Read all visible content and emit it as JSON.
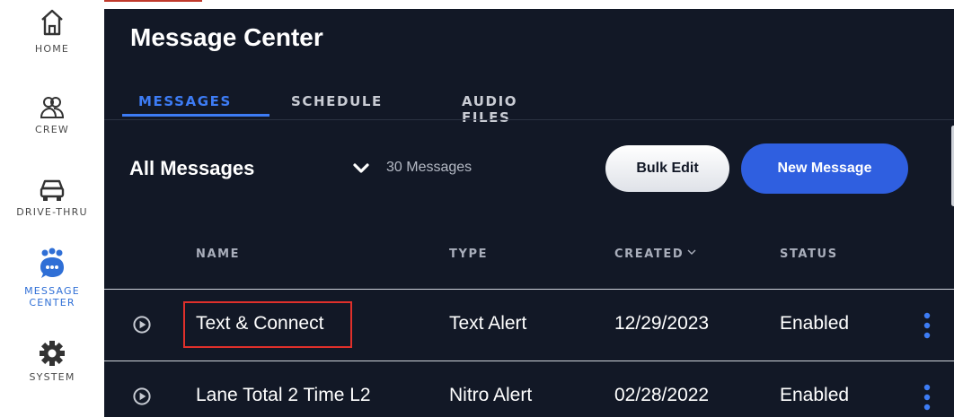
{
  "sidebar": {
    "items": [
      {
        "label": "HOME",
        "icon": "home-icon"
      },
      {
        "label": "CREW",
        "icon": "crew-icon"
      },
      {
        "label": "DRIVE-THRU",
        "icon": "car-icon"
      },
      {
        "label": "MESSAGE CENTER",
        "icon": "message-center-icon",
        "active": true
      },
      {
        "label": "SYSTEM",
        "icon": "gear-icon"
      }
    ]
  },
  "header": {
    "title": "Message Center"
  },
  "tabs": [
    {
      "label": "MESSAGES",
      "active": true
    },
    {
      "label": "SCHEDULE"
    },
    {
      "label": "AUDIO FILES"
    }
  ],
  "filter": {
    "label": "All Messages",
    "count": "30 Messages"
  },
  "buttons": {
    "bulk_edit": "Bulk Edit",
    "new_message": "New Message"
  },
  "table": {
    "columns": [
      "NAME",
      "TYPE",
      "CREATED",
      "STATUS"
    ],
    "rows": [
      {
        "name": "Text & Connect",
        "type": "Text Alert",
        "created": "12/29/2023",
        "status": "Enabled"
      },
      {
        "name": "Lane Total 2 Time L2",
        "type": "Nitro Alert",
        "created": "02/28/2022",
        "status": "Enabled"
      }
    ]
  },
  "colors": {
    "background": "#121826",
    "accent": "#3d7cf5",
    "primary_button": "#2f5fe0",
    "highlight_box": "#e0302b"
  }
}
